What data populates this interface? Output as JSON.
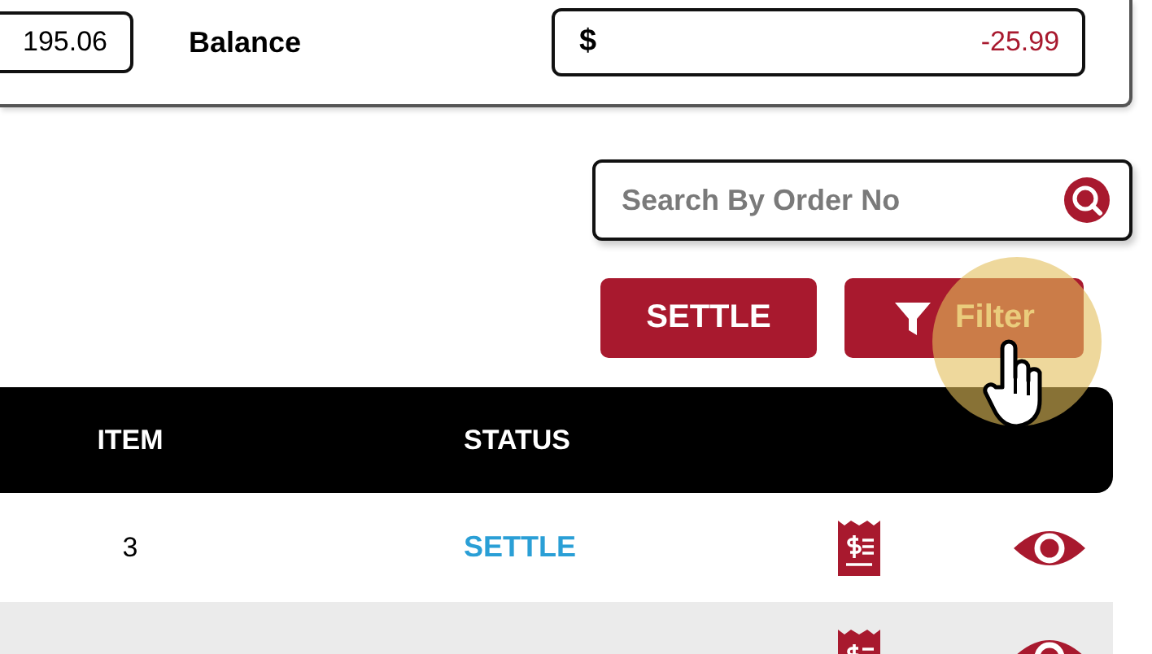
{
  "summary": {
    "amount_value": "195.06",
    "balance_label": "Balance",
    "balance_currency": "$",
    "balance_value": "-25.99"
  },
  "search": {
    "placeholder": "Search By Order No"
  },
  "actions": [
    {
      "label": "SETTLE",
      "kind": "plain"
    },
    {
      "label": "Filter",
      "kind": "filter"
    }
  ],
  "table": {
    "columns": [
      "ITEM",
      "STATUS"
    ],
    "rows": [
      {
        "item": "3",
        "status": "SETTLE",
        "shaded": false
      },
      {
        "shaded": true
      }
    ]
  }
}
